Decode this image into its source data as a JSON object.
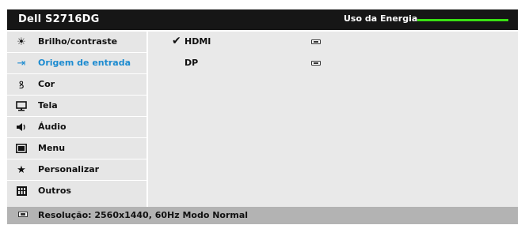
{
  "header": {
    "title": "Dell S2716DG",
    "energy_label": "Uso da Energia",
    "energy_level": 1.0,
    "energy_color": "#39e013"
  },
  "sidebar": {
    "active_color": "#1c8bd0",
    "items": [
      {
        "label": "Brilho/contraste",
        "icon": "brightness-icon"
      },
      {
        "label": "Origem de entrada",
        "icon": "input-source-icon",
        "active": true
      },
      {
        "label": "Cor",
        "icon": "color-icon"
      },
      {
        "label": "Tela",
        "icon": "display-icon"
      },
      {
        "label": "Áudio",
        "icon": "speaker-icon"
      },
      {
        "label": "Menu",
        "icon": "menu-icon"
      },
      {
        "label": "Personalizar",
        "icon": "star-icon"
      },
      {
        "label": "Outros",
        "icon": "others-icon"
      }
    ]
  },
  "options": [
    {
      "label": "HDMI",
      "selected": true,
      "icon": "hdmi-port-icon"
    },
    {
      "label": "DP",
      "selected": false,
      "icon": "dp-port-icon"
    }
  ],
  "footer": {
    "status": "Resolução: 2560x1440, 60Hz Modo Normal",
    "icon": "connector-icon"
  }
}
